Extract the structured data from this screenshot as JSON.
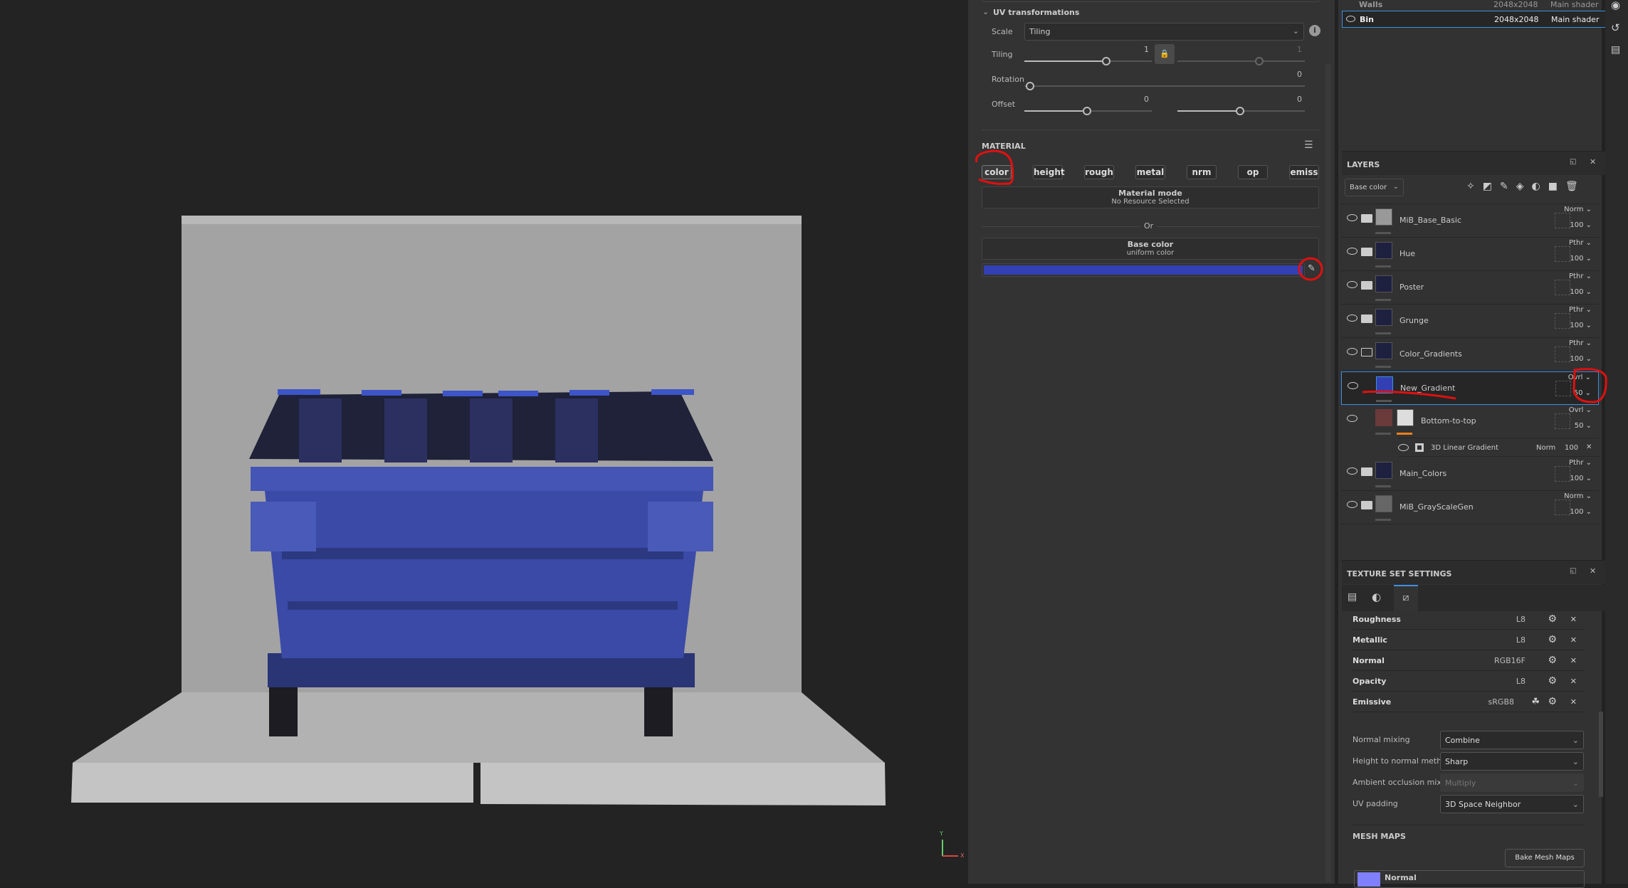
{
  "uv": {
    "title": "UV transformations",
    "scale_label": "Scale",
    "scale_value": "Tiling",
    "tiling_label": "Tiling",
    "tiling_u": "1",
    "tiling_v": "1",
    "rotation_label": "Rotation",
    "rotation_value": "0",
    "offset_label": "Offset",
    "offset_u": "0",
    "offset_v": "0"
  },
  "material": {
    "title": "MATERIAL",
    "channels": [
      "color",
      "height",
      "rough",
      "metal",
      "nrm",
      "op",
      "emiss"
    ],
    "active_channel": "color",
    "mode_title": "Material mode",
    "mode_value": "No Resource Selected",
    "or": "Or",
    "base_title": "Base color",
    "base_sub": "uniform color",
    "base_color": "#3340b3"
  },
  "texture_sets": [
    {
      "name": "Walls",
      "res": "2048x2048",
      "shader": "Main shader"
    },
    {
      "name": "Bin",
      "res": "2048x2048",
      "shader": "Main shader",
      "selected": true
    }
  ],
  "layers": {
    "title": "LAYERS",
    "channel": "Base color",
    "items": [
      {
        "name": "MiB_Base_Basic",
        "blend": "Norm",
        "opacity": "100"
      },
      {
        "name": "Hue",
        "blend": "Pthr",
        "opacity": "100"
      },
      {
        "name": "Poster",
        "blend": "Pthr",
        "opacity": "100"
      },
      {
        "name": "Grunge",
        "blend": "Pthr",
        "opacity": "100"
      },
      {
        "name": "Color_Gradients",
        "blend": "Pthr",
        "opacity": "100"
      },
      {
        "name": "New_Gradient",
        "blend": "Ovrl",
        "opacity": "50",
        "selected": true
      },
      {
        "name": "Bottom-to-top",
        "blend": "Ovrl",
        "opacity": "50"
      },
      {
        "name": "Main_Colors",
        "blend": "Pthr",
        "opacity": "100"
      },
      {
        "name": "MiB_GrayScaleGen",
        "blend": "Norm",
        "opacity": "100"
      }
    ],
    "effect": {
      "name": "3D Linear Gradient",
      "blend": "Norm",
      "opacity": "100"
    }
  },
  "tss": {
    "title": "TEXTURE SET SETTINGS",
    "channels": [
      {
        "name": "Roughness",
        "format": "L8"
      },
      {
        "name": "Metallic",
        "format": "L8"
      },
      {
        "name": "Normal",
        "format": "RGB16F"
      },
      {
        "name": "Opacity",
        "format": "L8"
      },
      {
        "name": "Emissive",
        "format": "sRGB8"
      }
    ],
    "normal_mixing_label": "Normal mixing",
    "normal_mixing": "Combine",
    "h2n_label": "Height to normal method",
    "h2n": "Sharp",
    "ao_label": "Ambient occlusion mixing",
    "ao": "Multiply",
    "uvpad_label": "UV padding",
    "uvpad": "3D Space Neighbor",
    "mesh_maps_title": "MESH MAPS",
    "bake_label": "Bake Mesh Maps",
    "mesh_map_first": "Normal"
  },
  "gizmo": {
    "y": "Y",
    "x": "X"
  }
}
